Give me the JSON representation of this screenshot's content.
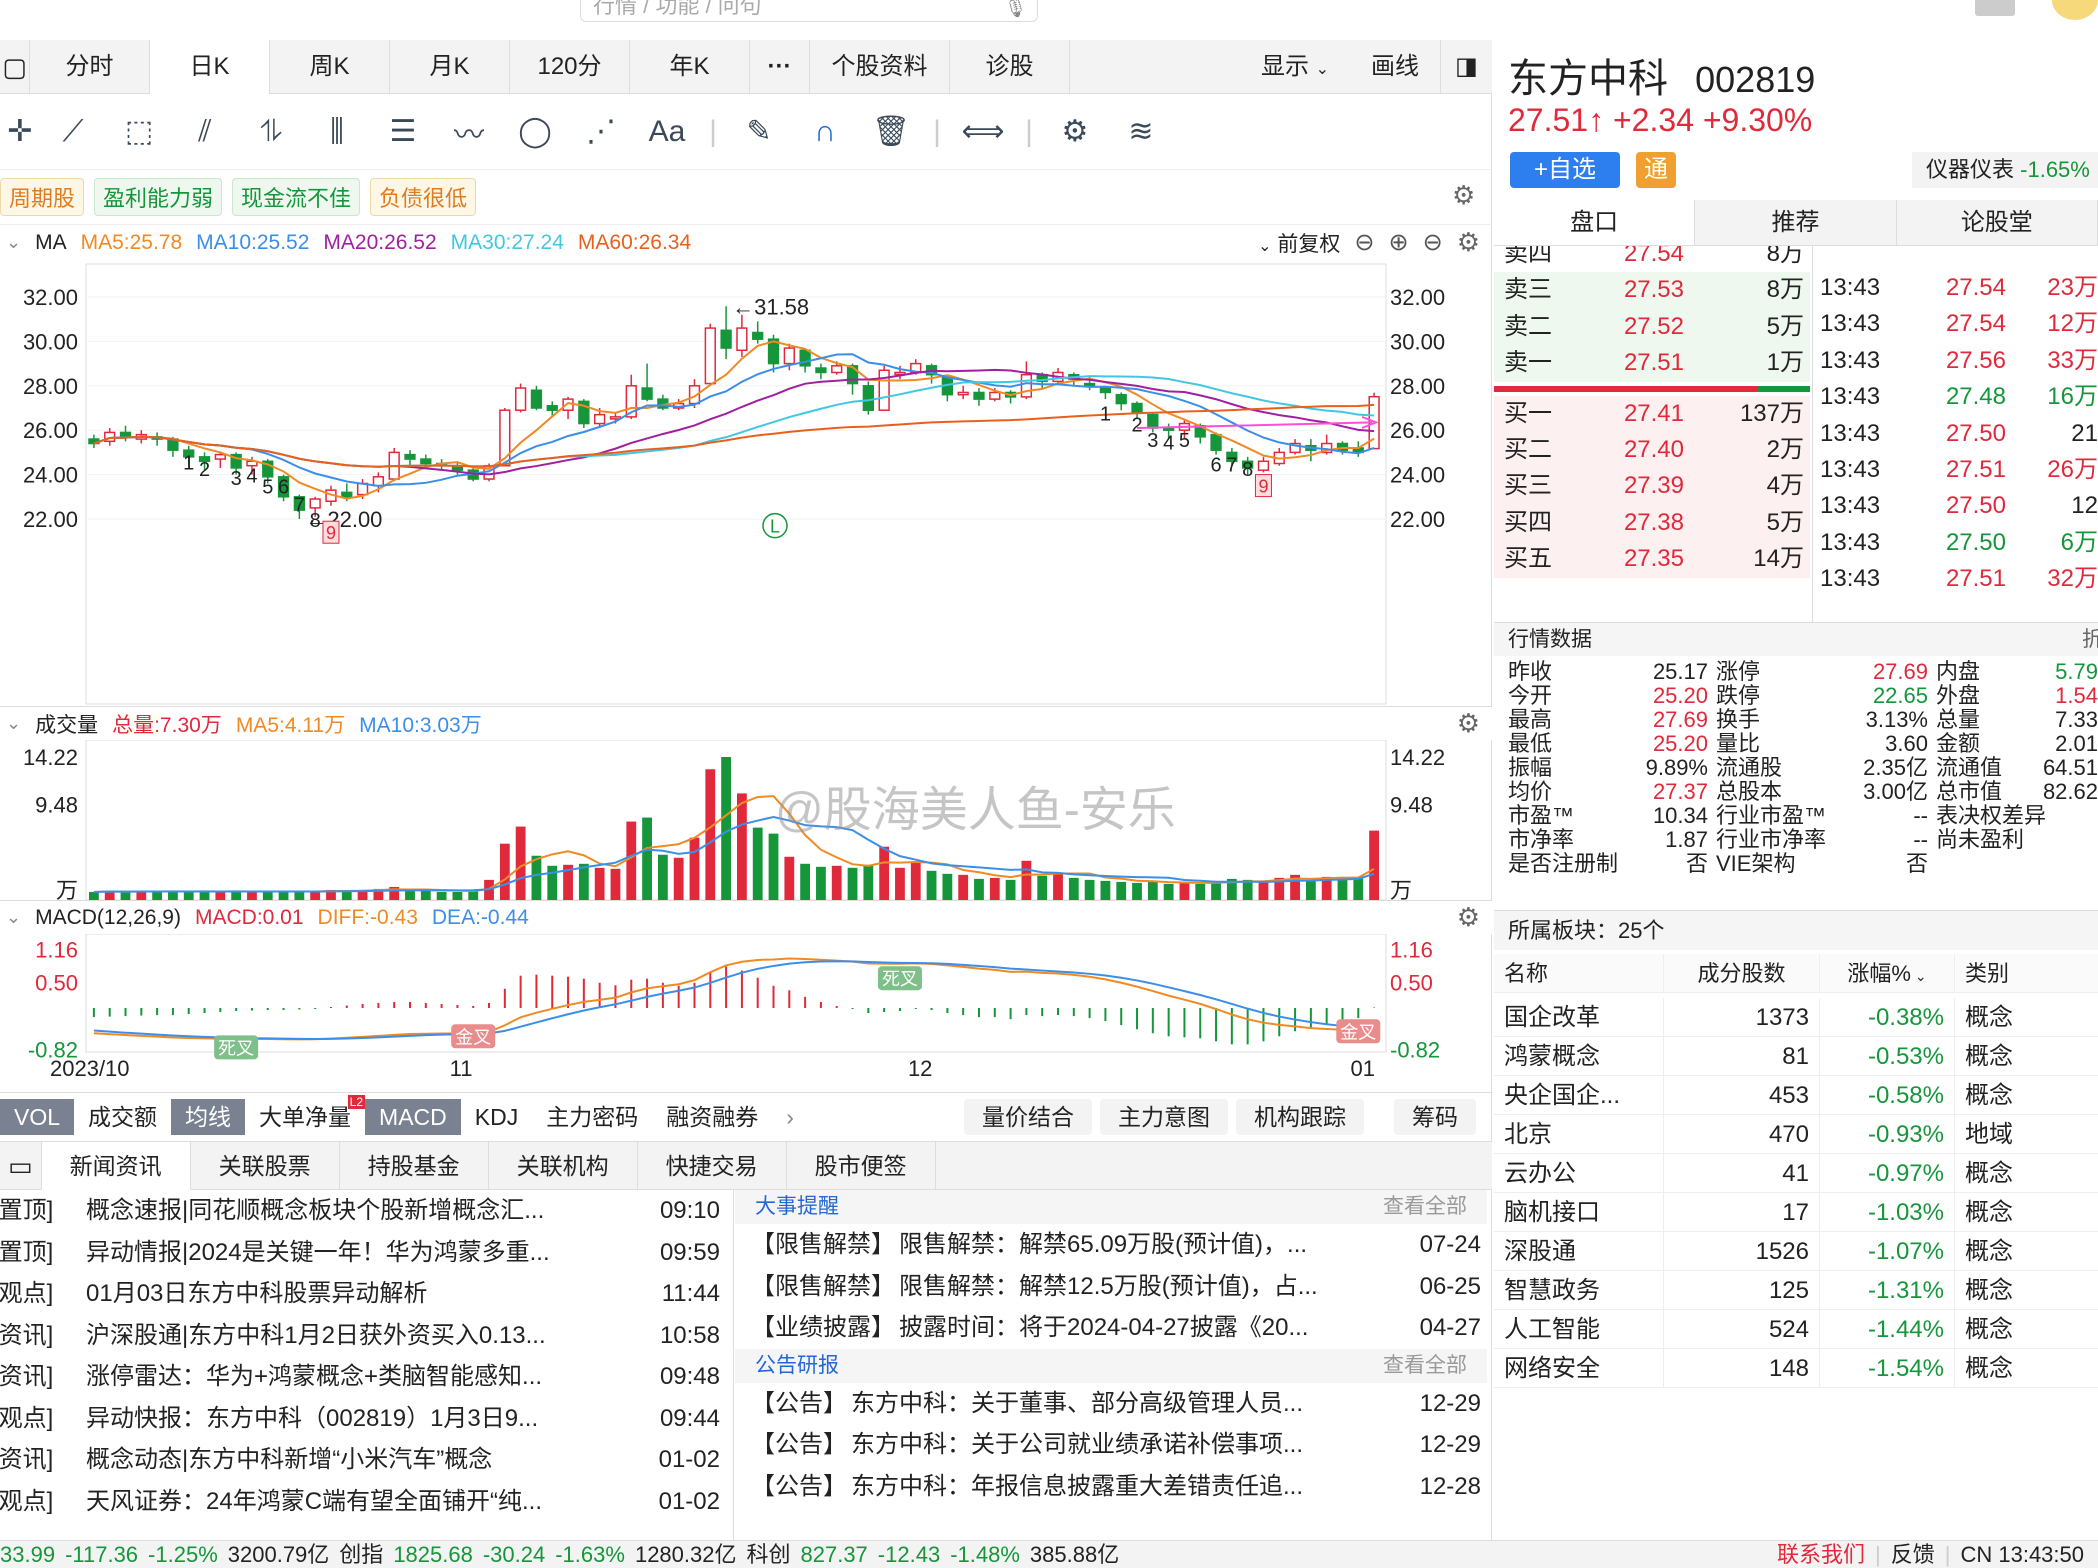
{
  "search": {
    "placeholder": "行情 / 功能 / 问句"
  },
  "colors": {
    "up": "#e0293b",
    "down": "#16963b",
    "ma5": "#f08a24",
    "ma10": "#3b8fe8",
    "ma20": "#a020a0",
    "ma30": "#40c8e0",
    "ma60": "#e8601c"
  },
  "tabs": [
    "分时",
    "日K",
    "周K",
    "月K",
    "120分",
    "年K",
    "···",
    "个股资料",
    "诊股"
  ],
  "active_tab": "日K",
  "display_label": "显示",
  "draw_label": "画线",
  "tags": [
    "周期股",
    "盈利能力弱",
    "现金流不佳",
    "负债很低"
  ],
  "ma_legend": {
    "name": "MA",
    "ma5": "MA5:25.78",
    "ma10": "MA10:25.52",
    "ma20": "MA20:26.52",
    "ma30": "MA30:27.24",
    "ma60": "MA60:26.34",
    "adjust": "前复权"
  },
  "price_axis": [
    "32.00",
    "30.00",
    "28.00",
    "26.00",
    "24.00",
    "22.00"
  ],
  "kline_annotations": {
    "high": "←31.58",
    "low": "←22.00",
    "l_marker": "L"
  },
  "volume_legend": {
    "name": "成交量",
    "total": "总量:7.30万",
    "ma5": "MA5:4.11万",
    "ma10": "MA10:3.03万"
  },
  "vol_axis": [
    "14.22",
    "9.48",
    "万"
  ],
  "macd_legend": {
    "name": "MACD(12,26,9)",
    "macd": "MACD:0.01",
    "diff": "DIFF:-0.43",
    "dea": "DEA:-0.44"
  },
  "macd_axis": [
    "1.16",
    "0.50",
    "-0.82"
  ],
  "macd_marks": {
    "dead1": "死叉",
    "gold1": "金叉",
    "dead2": "死叉",
    "gold2": "金叉"
  },
  "date_axis": [
    "2023/10",
    "11",
    "12",
    "01"
  ],
  "watermark": "@股海美人鱼-安乐",
  "indicator_tabs": [
    "VOL",
    "成交额",
    "均线",
    "大单净量",
    "MACD",
    "KDJ",
    "主力密码",
    "融资融券"
  ],
  "indicator_badge": "L2",
  "indicator_buttons": [
    "量价结合",
    "主力意图",
    "机构跟踪",
    "筹码"
  ],
  "news_tabs": [
    "新闻资讯",
    "关联股票",
    "持股基金",
    "关联机构",
    "快捷交易",
    "股市便签"
  ],
  "news": [
    {
      "tag": "[置顶]",
      "title": "概念速报|同花顺概念板块个股新增概念汇...",
      "time": "09:10"
    },
    {
      "tag": "[置顶]",
      "title": "异动情报|2024是关键一年！华为鸿蒙多重...",
      "time": "09:59"
    },
    {
      "tag": "[观点]",
      "title": "01月03日东方中科股票异动解析",
      "time": "11:44"
    },
    {
      "tag": "[资讯]",
      "title": "沪深股通|东方中科1月2日获外资买入0.13...",
      "time": "10:58"
    },
    {
      "tag": "[资讯]",
      "title": "涨停雷达：华为+鸿蒙概念+类脑智能感知...",
      "time": "09:48"
    },
    {
      "tag": "[观点]",
      "title": "异动快报：东方中科（002819）1月3日9...",
      "time": "09:44"
    },
    {
      "tag": "[资讯]",
      "title": "概念动态|东方中科新增“小米汽车”概念",
      "time": "01-02"
    },
    {
      "tag": "[观点]",
      "title": "天风证券：24年鸿蒙C端有望全面铺开“纯...",
      "time": "01-02"
    }
  ],
  "events_header": "大事提醒",
  "view_all": "查看全部",
  "events": [
    {
      "tag": "【限售解禁】",
      "title": "限售解禁：解禁65.09万股(预计值)，...",
      "date": "07-24"
    },
    {
      "tag": "【限售解禁】",
      "title": "限售解禁：解禁12.5万股(预计值)，占...",
      "date": "06-25"
    },
    {
      "tag": "【业绩披露】",
      "title": "披露时间：将于2024-04-27披露《20...",
      "date": "04-27"
    }
  ],
  "notices_header": "公告研报",
  "notices": [
    {
      "tag": "【公告】",
      "title": "东方中科：关于董事、部分高级管理人员...",
      "date": "12-29"
    },
    {
      "tag": "【公告】",
      "title": "东方中科：关于公司就业绩承诺补偿事项...",
      "date": "12-29"
    },
    {
      "tag": "【公告】",
      "title": "东方中科：年报信息披露重大差错责任追...",
      "date": "12-28"
    }
  ],
  "status": [
    {
      "text": "33.99",
      "c": "g"
    },
    {
      "text": "-117.36",
      "c": "g"
    },
    {
      "text": "-1.25%",
      "c": "g"
    },
    {
      "text": "3200.79亿",
      "c": ""
    },
    {
      "text": "创指",
      "c": ""
    },
    {
      "text": "1825.68",
      "c": "g"
    },
    {
      "text": "-30.24",
      "c": "g"
    },
    {
      "text": "-1.63%",
      "c": "g"
    },
    {
      "text": "1280.32亿",
      "c": ""
    },
    {
      "text": "科创",
      "c": ""
    },
    {
      "text": "827.37",
      "c": "g"
    },
    {
      "text": "-12.43",
      "c": "g"
    },
    {
      "text": "-1.48%",
      "c": "g"
    },
    {
      "text": "385.88亿",
      "c": ""
    }
  ],
  "status_right": {
    "contact": "联系我们",
    "feedback": "反馈",
    "clock": "CN 13:43:50"
  },
  "stock": {
    "name": "东方中科",
    "code": "002819",
    "price": "27.51↑",
    "change": "+2.34",
    "pct": "+9.30%",
    "add_watch": "+自选",
    "tong": "通",
    "sector": "仪器仪表",
    "sector_pct": "-1.65%"
  },
  "right_tabs": [
    "盘口",
    "推荐",
    "论股堂"
  ],
  "asks": [
    {
      "label": "卖四",
      "price": "27.54",
      "vol": "8万"
    },
    {
      "label": "卖三",
      "price": "27.53",
      "vol": "8万"
    },
    {
      "label": "卖二",
      "price": "27.52",
      "vol": "5万"
    },
    {
      "label": "卖一",
      "price": "27.51",
      "vol": "1万"
    }
  ],
  "bids": [
    {
      "label": "买一",
      "price": "27.41",
      "vol": "137万"
    },
    {
      "label": "买二",
      "price": "27.40",
      "vol": "2万"
    },
    {
      "label": "买三",
      "price": "27.39",
      "vol": "4万"
    },
    {
      "label": "买四",
      "price": "27.38",
      "vol": "5万"
    },
    {
      "label": "买五",
      "price": "27.35",
      "vol": "14万"
    }
  ],
  "trades": [
    {
      "time": "13:43",
      "price": "27.54",
      "vol": "23万",
      "c": "r"
    },
    {
      "time": "13:43",
      "price": "27.54",
      "vol": "12万",
      "c": "r"
    },
    {
      "time": "13:43",
      "price": "27.56",
      "vol": "33万",
      "c": "r"
    },
    {
      "time": "13:43",
      "price": "27.48",
      "vol": "16万",
      "c": "g"
    },
    {
      "time": "13:43",
      "price": "27.50",
      "vol": "21",
      "c": "k"
    },
    {
      "time": "13:43",
      "price": "27.51",
      "vol": "26万",
      "c": "r"
    },
    {
      "time": "13:43",
      "price": "27.50",
      "vol": "12",
      "c": "k"
    },
    {
      "time": "13:43",
      "price": "27.50",
      "vol": "6万",
      "c": "g"
    },
    {
      "time": "13:43",
      "price": "27.51",
      "vol": "32万",
      "c": "r"
    }
  ],
  "quote_header": "行情数据",
  "quote_fold": "折叠",
  "quote": [
    [
      {
        "k": "昨收",
        "v": "25.17",
        "c": ""
      },
      {
        "k": "涨停",
        "v": "27.69",
        "c": "r"
      },
      {
        "k": "内盘",
        "v": "5.79",
        "c": "g"
      }
    ],
    [
      {
        "k": "今开",
        "v": "25.20",
        "c": "r"
      },
      {
        "k": "跌停",
        "v": "22.65",
        "c": "g"
      },
      {
        "k": "外盘",
        "v": "1.54",
        "c": "r"
      }
    ],
    [
      {
        "k": "最高",
        "v": "27.69",
        "c": "r"
      },
      {
        "k": "换手",
        "v": "3.13%",
        "c": ""
      },
      {
        "k": "总量",
        "v": "7.33",
        "c": ""
      }
    ],
    [
      {
        "k": "最低",
        "v": "25.20",
        "c": "r"
      },
      {
        "k": "量比",
        "v": "3.60",
        "c": ""
      },
      {
        "k": "金额",
        "v": "2.01",
        "c": ""
      }
    ],
    [
      {
        "k": "振幅",
        "v": "9.89%",
        "c": ""
      },
      {
        "k": "流通股",
        "v": "2.35亿",
        "c": ""
      },
      {
        "k": "流通值",
        "v": "64.51",
        "c": ""
      }
    ],
    [
      {
        "k": "均价",
        "v": "27.37",
        "c": "r"
      },
      {
        "k": "总股本",
        "v": "3.00亿",
        "c": ""
      },
      {
        "k": "总市值",
        "v": "82.62",
        "c": ""
      }
    ],
    [
      {
        "k": "市盈™",
        "v": "10.34",
        "c": ""
      },
      {
        "k": "行业市盈™",
        "v": "--",
        "c": ""
      },
      {
        "k": "表决权差异",
        "v": "",
        "c": ""
      }
    ],
    [
      {
        "k": "市净率",
        "v": "1.87",
        "c": ""
      },
      {
        "k": "行业市净率",
        "v": "--",
        "c": ""
      },
      {
        "k": "尚未盈利",
        "v": "",
        "c": ""
      }
    ],
    [
      {
        "k": "是否注册制",
        "v": "否",
        "c": ""
      },
      {
        "k": "VIE架构",
        "v": "否",
        "c": ""
      },
      {
        "k": "",
        "v": "",
        "c": ""
      }
    ]
  ],
  "boards_header": "所属板块：25个",
  "board_cols": [
    "名称",
    "成分股数",
    "涨幅%",
    "类别"
  ],
  "boards": [
    {
      "name": "国企改革",
      "count": "1373",
      "pct": "-0.38%",
      "type": "概念"
    },
    {
      "name": "鸿蒙概念",
      "count": "81",
      "pct": "-0.53%",
      "type": "概念"
    },
    {
      "name": "央企国企...",
      "count": "453",
      "pct": "-0.58%",
      "type": "概念"
    },
    {
      "name": "北京",
      "count": "470",
      "pct": "-0.93%",
      "type": "地域"
    },
    {
      "name": "云办公",
      "count": "41",
      "pct": "-0.97%",
      "type": "概念"
    },
    {
      "name": "脑机接口",
      "count": "17",
      "pct": "-1.03%",
      "type": "概念"
    },
    {
      "name": "深股通",
      "count": "1526",
      "pct": "-1.07%",
      "type": "概念"
    },
    {
      "name": "智慧政务",
      "count": "125",
      "pct": "-1.31%",
      "type": "概念"
    },
    {
      "name": "人工智能",
      "count": "524",
      "pct": "-1.44%",
      "type": "概念"
    },
    {
      "name": "网络安全",
      "count": "148",
      "pct": "-1.54%",
      "type": "概念"
    }
  ],
  "chart_data": {
    "type": "candlestick",
    "candles": [
      [
        25.6,
        25.4,
        25.8,
        25.2
      ],
      [
        25.5,
        25.9,
        26.1,
        25.3
      ],
      [
        25.9,
        25.7,
        26.2,
        25.5
      ],
      [
        25.6,
        25.8,
        26.0,
        25.4
      ],
      [
        25.7,
        25.6,
        25.9,
        25.3
      ],
      [
        25.6,
        25.1,
        25.7,
        24.8
      ],
      [
        25.1,
        24.8,
        25.3,
        24.4
      ],
      [
        24.8,
        24.6,
        25.0,
        24.2
      ],
      [
        24.7,
        24.9,
        25.0,
        24.3
      ],
      [
        24.9,
        24.3,
        25.0,
        24.0
      ],
      [
        24.4,
        24.6,
        24.8,
        24.0
      ],
      [
        24.6,
        23.9,
        24.7,
        23.6
      ],
      [
        23.9,
        23.0,
        24.0,
        22.8
      ],
      [
        23.0,
        22.4,
        23.1,
        22.0
      ],
      [
        22.5,
        22.9,
        23.0,
        22.1
      ],
      [
        22.8,
        23.3,
        23.5,
        22.6
      ],
      [
        23.2,
        23.0,
        23.6,
        22.8
      ],
      [
        23.1,
        23.6,
        23.8,
        22.9
      ],
      [
        23.5,
        23.9,
        24.1,
        23.2
      ],
      [
        23.8,
        25.0,
        25.2,
        23.7
      ],
      [
        24.9,
        24.7,
        25.1,
        24.4
      ],
      [
        24.7,
        24.5,
        24.9,
        24.3
      ],
      [
        24.5,
        24.4,
        24.7,
        24.2
      ],
      [
        24.4,
        24.2,
        24.6,
        24.0
      ],
      [
        24.2,
        23.8,
        24.3,
        23.7
      ],
      [
        23.8,
        24.4,
        24.5,
        23.7
      ],
      [
        24.4,
        26.9,
        27.0,
        24.4
      ],
      [
        26.9,
        27.9,
        28.1,
        26.8
      ],
      [
        27.8,
        27.0,
        28.0,
        26.9
      ],
      [
        27.1,
        26.9,
        27.3,
        26.6
      ],
      [
        26.9,
        27.4,
        27.5,
        26.5
      ],
      [
        27.3,
        26.3,
        27.4,
        26.1
      ],
      [
        26.3,
        26.7,
        27.0,
        26.1
      ],
      [
        26.6,
        26.6,
        26.8,
        26.3
      ],
      [
        26.6,
        28.0,
        28.5,
        26.5
      ],
      [
        27.9,
        27.4,
        29.0,
        27.3
      ],
      [
        27.4,
        27.0,
        27.6,
        26.9
      ],
      [
        27.0,
        27.2,
        27.4,
        26.9
      ],
      [
        27.2,
        28.0,
        28.3,
        27.0
      ],
      [
        28.1,
        30.6,
        30.8,
        28.0
      ],
      [
        30.5,
        29.7,
        31.58,
        29.2
      ],
      [
        29.6,
        30.6,
        31.2,
        29.3
      ],
      [
        30.4,
        30.1,
        30.9,
        29.9
      ],
      [
        30.1,
        29.0,
        30.3,
        28.6
      ],
      [
        29.0,
        29.7,
        29.9,
        28.7
      ],
      [
        29.6,
        28.9,
        29.7,
        28.6
      ],
      [
        28.8,
        28.6,
        29.0,
        28.3
      ],
      [
        28.6,
        28.9,
        29.1,
        28.5
      ],
      [
        28.9,
        28.1,
        29.0,
        27.6
      ],
      [
        28.0,
        26.9,
        28.2,
        26.7
      ],
      [
        26.9,
        28.7,
        28.9,
        26.9
      ],
      [
        28.6,
        28.6,
        28.9,
        28.3
      ],
      [
        28.6,
        29.0,
        29.2,
        28.5
      ],
      [
        28.9,
        28.5,
        29.0,
        28.1
      ],
      [
        28.4,
        27.6,
        28.5,
        27.3
      ],
      [
        27.6,
        27.7,
        28.0,
        27.4
      ],
      [
        27.7,
        27.4,
        27.9,
        27.1
      ],
      [
        27.4,
        27.7,
        27.9,
        27.3
      ],
      [
        27.7,
        27.5,
        27.8,
        27.2
      ],
      [
        27.5,
        28.5,
        29.1,
        27.4
      ],
      [
        28.5,
        28.2,
        28.6,
        27.9
      ],
      [
        28.2,
        28.6,
        28.8,
        28.1
      ],
      [
        28.5,
        28.3,
        28.6,
        28.0
      ],
      [
        28.1,
        28.0,
        28.4,
        27.8
      ],
      [
        27.9,
        27.7,
        28.0,
        27.4
      ],
      [
        27.6,
        27.2,
        27.7,
        26.9
      ],
      [
        27.2,
        26.8,
        27.3,
        26.5
      ],
      [
        26.7,
        26.1,
        26.8,
        25.9
      ],
      [
        26.1,
        26.0,
        26.3,
        25.6
      ],
      [
        26.0,
        26.3,
        26.5,
        25.6
      ],
      [
        26.2,
        25.7,
        26.3,
        25.4
      ],
      [
        25.8,
        25.1,
        25.9,
        24.9
      ],
      [
        25.0,
        24.6,
        25.2,
        24.4
      ],
      [
        24.6,
        24.3,
        24.8,
        24.0
      ],
      [
        24.2,
        24.6,
        24.8,
        24.1
      ],
      [
        24.5,
        25.0,
        25.2,
        24.4
      ],
      [
        25.0,
        25.4,
        25.6,
        24.9
      ],
      [
        25.3,
        25.1,
        25.6,
        24.6
      ],
      [
        25.0,
        25.4,
        25.8,
        24.9
      ],
      [
        25.4,
        25.1,
        25.5,
        24.9
      ],
      [
        25.2,
        25.0,
        25.5,
        24.8
      ],
      [
        25.17,
        27.51,
        27.69,
        25.2
      ]
    ],
    "volume_unit": "万",
    "volumes": [
      0.8,
      0.9,
      0.8,
      0.9,
      0.8,
      0.9,
      0.8,
      0.9,
      0.8,
      0.9,
      0.8,
      0.8,
      0.9,
      0.8,
      0.9,
      1.0,
      0.9,
      1.0,
      1.1,
      1.3,
      0.9,
      0.9,
      0.8,
      0.8,
      1.0,
      2.0,
      5.6,
      7.3,
      4.4,
      3.4,
      3.5,
      3.6,
      3.2,
      3.1,
      7.8,
      8.2,
      4.5,
      4.2,
      6.2,
      13.0,
      14.22,
      10.6,
      7.2,
      6.6,
      4.3,
      3.6,
      3.3,
      3.4,
      3.2,
      3.5,
      5.3,
      3.2,
      3.7,
      2.9,
      2.6,
      2.5,
      2.1,
      2.2,
      2.0,
      3.9,
      2.4,
      2.7,
      2.2,
      2.0,
      1.9,
      1.8,
      1.7,
      1.9,
      1.6,
      1.7,
      1.6,
      1.8,
      2.1,
      2.0,
      1.8,
      2.2,
      2.5,
      2.0,
      2.3,
      2.1,
      2.2,
      6.9
    ],
    "macd_hist": [
      -0.18,
      -0.17,
      -0.16,
      -0.15,
      -0.14,
      -0.14,
      -0.12,
      -0.1,
      -0.08,
      -0.06,
      -0.05,
      -0.04,
      -0.04,
      -0.03,
      -0.02,
      0.02,
      0.05,
      0.08,
      0.1,
      0.12,
      0.12,
      0.1,
      0.08,
      0.06,
      0.04,
      0.1,
      0.38,
      0.64,
      0.66,
      0.64,
      0.62,
      0.58,
      0.5,
      0.45,
      0.56,
      0.58,
      0.5,
      0.44,
      0.5,
      0.72,
      0.82,
      0.74,
      0.6,
      0.44,
      0.35,
      0.22,
      0.12,
      0.04,
      -0.02,
      -0.1,
      -0.08,
      -0.06,
      -0.02,
      -0.04,
      -0.1,
      -0.14,
      -0.18,
      -0.18,
      -0.22,
      -0.14,
      -0.16,
      -0.14,
      -0.16,
      -0.2,
      -0.26,
      -0.34,
      -0.42,
      -0.5,
      -0.56,
      -0.58,
      -0.6,
      -0.66,
      -0.72,
      -0.72,
      -0.66,
      -0.56,
      -0.46,
      -0.4,
      -0.32,
      -0.26,
      -0.2,
      0.01
    ]
  }
}
